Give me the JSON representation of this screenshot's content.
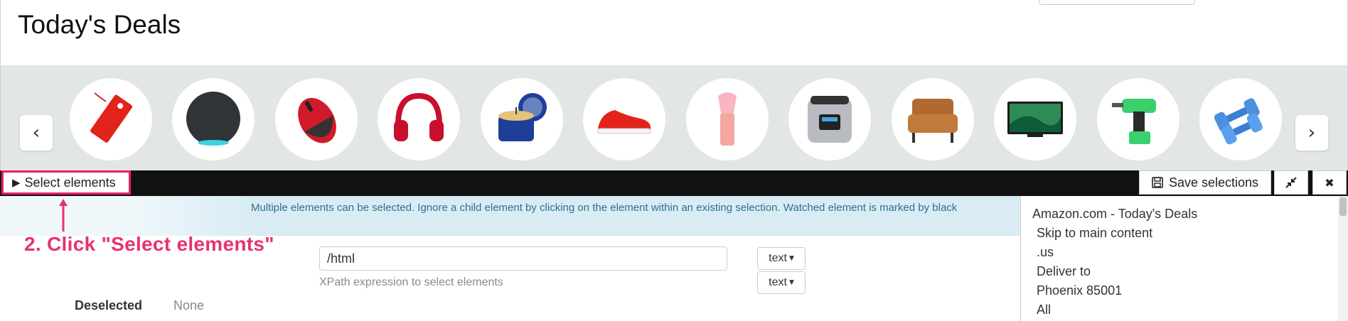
{
  "page": {
    "title": "Today's Deals"
  },
  "categories": [
    {
      "name": "tag-icon"
    },
    {
      "name": "smart-speaker-icon"
    },
    {
      "name": "mouse-icon"
    },
    {
      "name": "headphones-icon"
    },
    {
      "name": "candle-icon"
    },
    {
      "name": "sneaker-icon"
    },
    {
      "name": "makeup-brush-icon"
    },
    {
      "name": "pressure-cooker-icon"
    },
    {
      "name": "armchair-icon"
    },
    {
      "name": "tv-icon"
    },
    {
      "name": "drill-icon"
    },
    {
      "name": "dumbbells-icon"
    }
  ],
  "toolbar": {
    "select_label": "Select elements",
    "save_label": "Save selections"
  },
  "panel": {
    "info": "Multiple elements can be selected. Ignore a child element by clicking on the element within an existing selection. Watched element is marked by black",
    "xpath_value": "/html",
    "xpath_help": "XPath expression to select elements",
    "type_1": "text",
    "type_2": "text",
    "deselected_label": "Deselected",
    "deselected_value": "None"
  },
  "annotation": {
    "text": "2. Click \"Select elements\""
  },
  "side_list": [
    "Amazon.com - Today's Deals",
    "Skip to main content",
    ".us",
    "Deliver to",
    "Phoenix 85001",
    "All"
  ],
  "colors": {
    "accent": "#e91e63",
    "info_bg": "#d9ecf4",
    "strip_bg": "#e3e6e6"
  }
}
